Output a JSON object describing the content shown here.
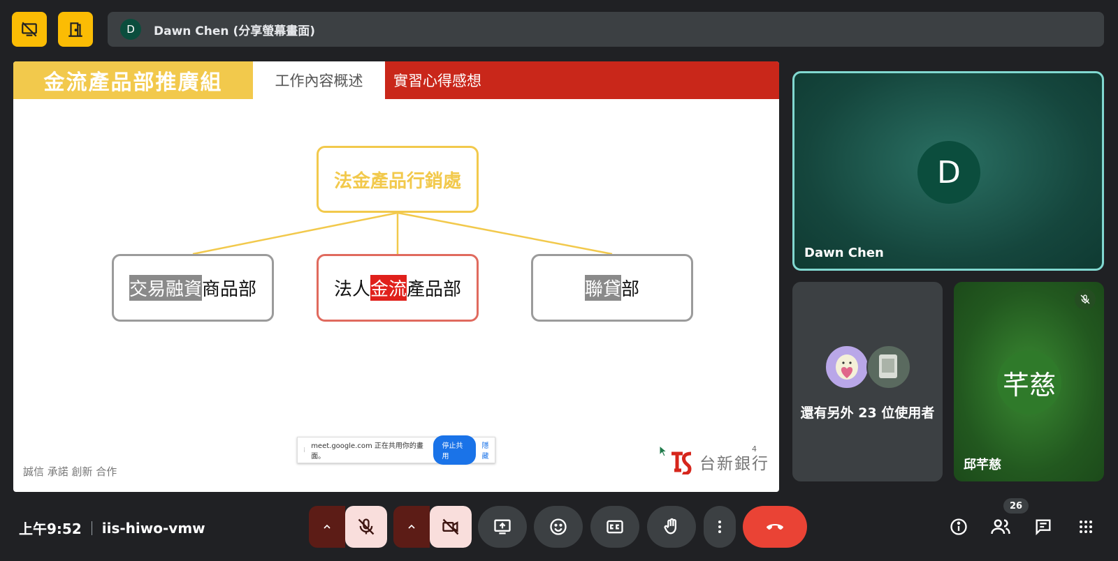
{
  "presenter": {
    "avatar_letter": "D",
    "text": "Dawn Chen (分享螢幕畫面)"
  },
  "slide": {
    "title": "金流產品部推廣組",
    "tab1": "工作內容概述",
    "tab2": "實習心得感想",
    "org": {
      "top": "法金產品行銷處",
      "left_hl": "交易融資",
      "left_rest": "商品部",
      "mid_pre": "法人",
      "mid_hl": "金流",
      "mid_post": "產品部",
      "right_hl": "聯貸",
      "right_rest": "部"
    },
    "share_bar": {
      "text": "meet.google.com 正在共用你的畫面。",
      "stop": "停止共用",
      "hide": "隱藏"
    },
    "footer": "誠信 承諾 創新 合作",
    "page_number": "4",
    "bank_name": "台新銀行"
  },
  "tiles": {
    "dawn": {
      "avatar_letter": "D",
      "name": "Dawn Chen"
    },
    "others": {
      "text": "還有另外 23 位使用者"
    },
    "qiu": {
      "avatar_text": "芊慈",
      "name": "邱芊慈"
    }
  },
  "bottom": {
    "time": "上午9:52",
    "meeting_code": "iis-hiwo-vmw",
    "participant_count": "26"
  },
  "colors": {
    "accent_yellow": "#fbbc04",
    "leave_red": "#ea4335",
    "dawn_border": "#81d8d0"
  }
}
